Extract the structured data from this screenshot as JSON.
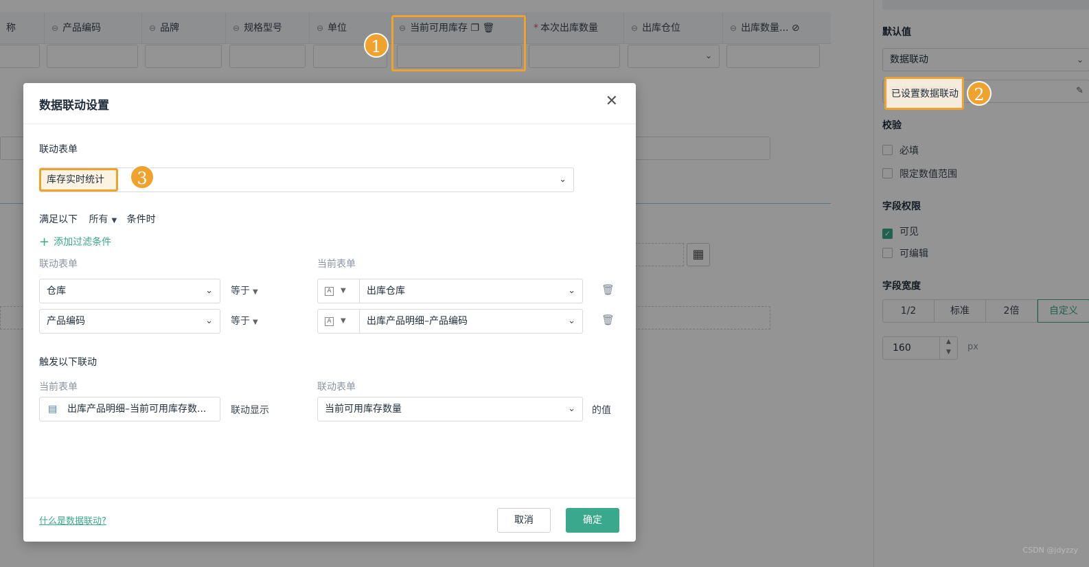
{
  "table": {
    "columns": [
      {
        "label": "称"
      },
      {
        "label": "产品编码"
      },
      {
        "label": "品牌"
      },
      {
        "label": "规格型号"
      },
      {
        "label": "单位"
      },
      {
        "label": "当前可用库存"
      },
      {
        "label": "本次出库数量"
      },
      {
        "label": "出库仓位"
      },
      {
        "label": "出库数量..."
      }
    ]
  },
  "right_panel": {
    "default_value_title": "默认值",
    "default_value_select": "数据联动",
    "linkage_status": "已设置数据联动",
    "validation_title": "校验",
    "required_label": "必填",
    "range_label": "限定数值范围",
    "permission_title": "字段权限",
    "visible_label": "可见",
    "editable_label": "可编辑",
    "width_title": "字段宽度",
    "width_options": [
      "1/2",
      "标准",
      "2倍",
      "自定义"
    ],
    "width_value": "160",
    "width_unit": "px"
  },
  "badges": [
    "1",
    "2",
    "3"
  ],
  "modal": {
    "title": "数据联动设置",
    "linked_form_label": "联动表单",
    "linked_form_value": "库存实时统计",
    "condition_prefix": "满足以下",
    "condition_mode": "所有",
    "condition_suffix": "条件时",
    "add_filter": "添加过滤条件",
    "col_linked": "联动表单",
    "col_current": "当前表单",
    "conditions": [
      {
        "left": "仓库",
        "op": "等于",
        "right": "出库仓库"
      },
      {
        "left": "产品编码",
        "op": "等于",
        "right": "出库产品明细–产品编码"
      }
    ],
    "trigger_title": "触发以下联动",
    "trigger_col_current": "当前表单",
    "trigger_col_linked": "联动表单",
    "trigger_current_field": "出库产品明细–当前可用库存数...",
    "trigger_action": "联动显示",
    "trigger_linked_field": "当前可用库存数量",
    "trigger_suffix": "的值",
    "help_link": "什么是数据联动?",
    "cancel": "取消",
    "confirm": "确定"
  },
  "watermark": "CSDN @jdyzzy",
  "colors": {
    "accent": "#3aa88a",
    "highlight": "#f0a22e"
  }
}
